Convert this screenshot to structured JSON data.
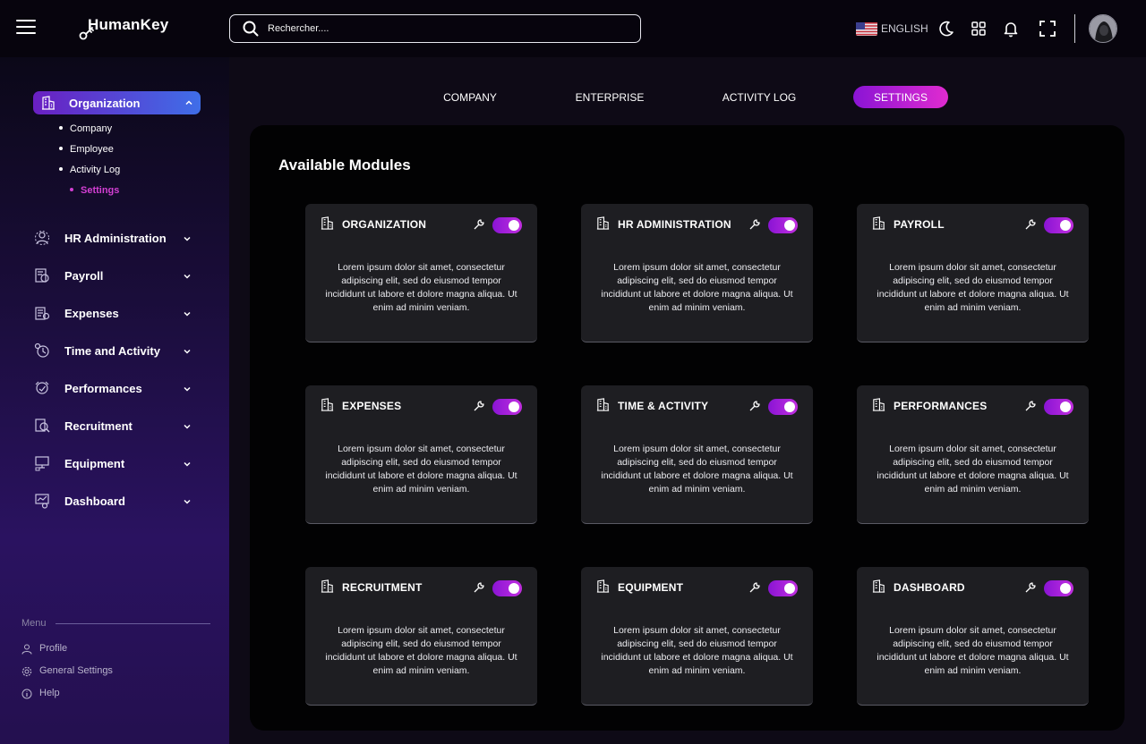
{
  "brand": {
    "name": "HumanKey"
  },
  "search": {
    "placeholder": "Rechercher...."
  },
  "header": {
    "language": "ENGLISH"
  },
  "colors": {
    "accent_purple": "#8a14d4",
    "accent_pink": "#e02bd0",
    "accent_blue": "#3f6ee8",
    "active_sub": "#d33fd3",
    "card_bg": "#1e1e22"
  },
  "sidebar": {
    "active": {
      "label": "Organization",
      "icon": "building-icon"
    },
    "sub_items": [
      {
        "label": "Company"
      },
      {
        "label": "Employee"
      },
      {
        "label": "Activity Log"
      },
      {
        "label": "Settings",
        "active": true
      }
    ],
    "items": [
      {
        "label": "HR Administration",
        "icon": "hr-admin-icon"
      },
      {
        "label": "Payroll",
        "icon": "payroll-icon"
      },
      {
        "label": "Expenses",
        "icon": "expenses-icon"
      },
      {
        "label": "Time and Activity",
        "icon": "time-activity-icon"
      },
      {
        "label": "Performances",
        "icon": "performances-icon"
      },
      {
        "label": "Recruitment",
        "icon": "recruitment-icon"
      },
      {
        "label": "Equipment",
        "icon": "equipment-icon"
      },
      {
        "label": "Dashboard",
        "icon": "dashboard-icon"
      }
    ],
    "menu_heading": "Menu",
    "bottom": [
      {
        "label": "Profile",
        "icon": "user-icon"
      },
      {
        "label": "General Settings",
        "icon": "gear-icon"
      },
      {
        "label": "Help",
        "icon": "info-icon"
      }
    ]
  },
  "tabs": [
    {
      "label": "COMPANY"
    },
    {
      "label": "ENTERPRISE"
    },
    {
      "label": "ACTIVITY LOG"
    },
    {
      "label": "SETTINGS",
      "active": true
    }
  ],
  "panel": {
    "title": "Available Modules"
  },
  "modules": [
    {
      "title": "ORGANIZATION",
      "enabled": true,
      "desc": "Lorem ipsum dolor sit amet, consectetur adipiscing elit, sed do eiusmod tempor incididunt ut labore et dolore magna aliqua. Ut enim ad minim veniam."
    },
    {
      "title": "HR ADMINISTRATION",
      "enabled": true,
      "desc": "Lorem ipsum dolor sit amet, consectetur adipiscing elit, sed do eiusmod tempor incididunt ut labore et dolore magna aliqua. Ut enim ad minim veniam."
    },
    {
      "title": "PAYROLL",
      "enabled": true,
      "desc": "Lorem ipsum dolor sit amet, consectetur adipiscing elit, sed do eiusmod tempor incididunt ut labore et dolore magna aliqua. Ut enim ad minim veniam."
    },
    {
      "title": "EXPENSES",
      "enabled": true,
      "desc": "Lorem ipsum dolor sit amet, consectetur adipiscing elit, sed do eiusmod tempor incididunt ut labore et dolore magna aliqua. Ut enim ad minim veniam."
    },
    {
      "title": "TIME & ACTIVITY",
      "enabled": true,
      "desc": "Lorem ipsum dolor sit amet, consectetur adipiscing elit, sed do eiusmod tempor incididunt ut labore et dolore magna aliqua. Ut enim ad minim veniam."
    },
    {
      "title": "PERFORMANCES",
      "enabled": true,
      "desc": "Lorem ipsum dolor sit amet, consectetur adipiscing elit, sed do eiusmod tempor incididunt ut labore et dolore magna aliqua. Ut enim ad minim veniam."
    },
    {
      "title": "RECRUITMENT",
      "enabled": true,
      "desc": "Lorem ipsum dolor sit amet, consectetur adipiscing elit, sed do eiusmod tempor incididunt ut labore et dolore magna aliqua. Ut enim ad minim veniam."
    },
    {
      "title": "EQUIPMENT",
      "enabled": true,
      "desc": "Lorem ipsum dolor sit amet, consectetur adipiscing elit, sed do eiusmod tempor incididunt ut labore et dolore magna aliqua. Ut enim ad minim veniam."
    },
    {
      "title": "DASHBOARD",
      "enabled": true,
      "desc": "Lorem ipsum dolor sit amet, consectetur adipiscing elit, sed do eiusmod tempor incididunt ut labore et dolore magna aliqua. Ut enim ad minim veniam."
    }
  ]
}
